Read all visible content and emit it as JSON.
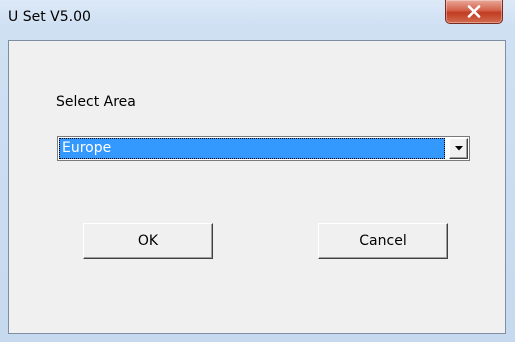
{
  "window": {
    "title": "U Set V5.00"
  },
  "dialog": {
    "area_label": "Select Area",
    "area_select": {
      "selected": "Europe"
    },
    "ok_label": "OK",
    "cancel_label": "Cancel"
  },
  "icons": {
    "close": "close-icon",
    "dropdown": "chevron-down-icon"
  },
  "colors": {
    "selection_highlight": "#3399ff",
    "close_button": "#c94a33",
    "dialog_background": "#f0f0f0",
    "frame": "#c6d9ee"
  }
}
